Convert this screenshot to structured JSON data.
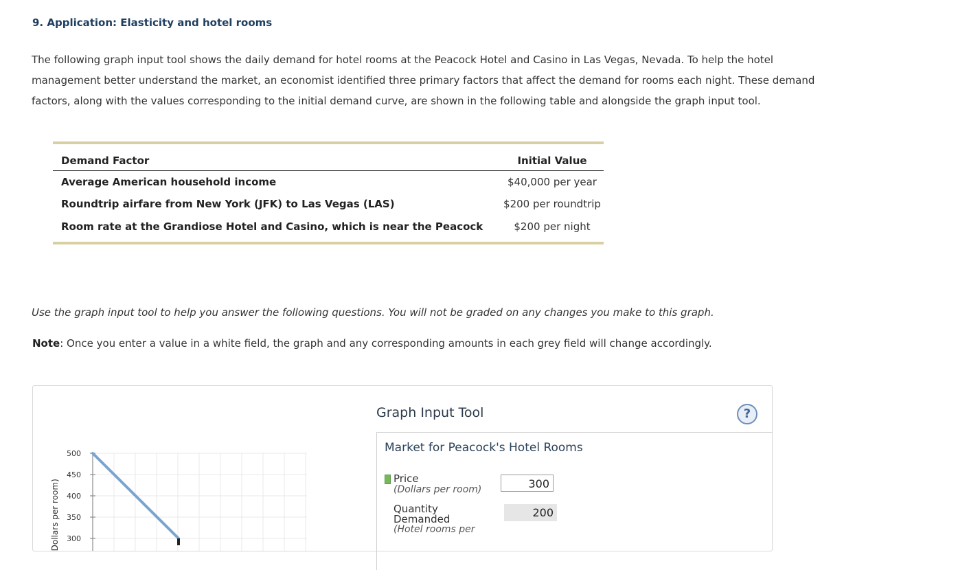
{
  "question": {
    "title": "9. Application: Elasticity and hotel rooms",
    "intro": "The following graph input tool shows the daily demand for hotel rooms at the Peacock Hotel and Casino in Las Vegas, Nevada. To help the hotel management better understand the market, an economist identified three primary factors that affect the demand for rooms each night. These demand factors, along with the values corresponding to the initial demand curve, are shown in the following table and alongside the graph input tool."
  },
  "table": {
    "headers": [
      "Demand Factor",
      "Initial Value"
    ],
    "rows": [
      {
        "factor": "Average American household income",
        "value": "$40,000 per year"
      },
      {
        "factor": "Roundtrip airfare from New York (JFK) to Las Vegas (LAS)",
        "value": "$200 per roundtrip"
      },
      {
        "factor": "Room rate at the Grandiose Hotel and Casino, which is near the Peacock",
        "value": "$200 per night"
      }
    ]
  },
  "instructions": {
    "usage": "Use the graph input tool to help you answer the following questions. You will not be graded on any changes you make to this graph.",
    "note_label": "Note",
    "note_text": ": Once you enter a value in a white field, the graph and any corresponding amounts in each grey field will change accordingly."
  },
  "tool": {
    "title": "Graph Input Tool",
    "help_icon": "question-mark-icon",
    "market_title": "Market for Peacock's Hotel Rooms",
    "price_label": "Price",
    "price_unit": "(Dollars per room)",
    "price_value": "300",
    "qty_label_1": "Quantity",
    "qty_label_2": "Demanded",
    "qty_unit": "(Hotel rooms per",
    "qty_value": "200",
    "swatch_color": "#76b95a"
  },
  "chart_data": {
    "type": "line",
    "ylabel": "(Dollars per room)",
    "y_ticks": [
      "500",
      "450",
      "400",
      "350",
      "300"
    ],
    "ylim": [
      300,
      500
    ],
    "series": [
      {
        "color": "#7aa3d1",
        "points": [
          {
            "x": 0,
            "y": 500
          },
          {
            "x": 200,
            "y": 300
          }
        ]
      }
    ],
    "marker": {
      "x": 200,
      "y": 300
    }
  }
}
